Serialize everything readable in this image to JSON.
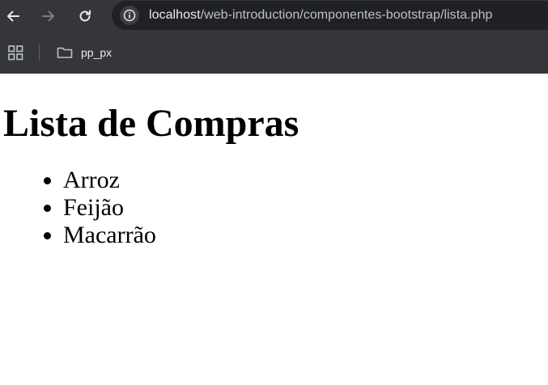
{
  "browser": {
    "url_host": "localhost",
    "url_path": "/web-introduction/componentes-bootstrap/lista.php",
    "nav": {
      "back_icon": "arrow-left-icon",
      "forward_icon": "arrow-right-icon",
      "reload_icon": "reload-icon",
      "site_info_icon": "info-icon"
    },
    "bookmarks": {
      "apps_icon": "apps-grid-icon",
      "items": [
        {
          "label": "pp_px",
          "icon": "folder-icon"
        }
      ]
    }
  },
  "page": {
    "title": "Lista de Compras",
    "items": [
      "Arroz",
      "Feijão",
      "Macarrão"
    ]
  },
  "colors": {
    "chrome_bg": "#35363a",
    "omnibox_bg": "#202124",
    "url_host": "#e8eaed",
    "url_path": "#bdc1c6",
    "page_bg": "#ffffff",
    "page_text": "#000000"
  }
}
